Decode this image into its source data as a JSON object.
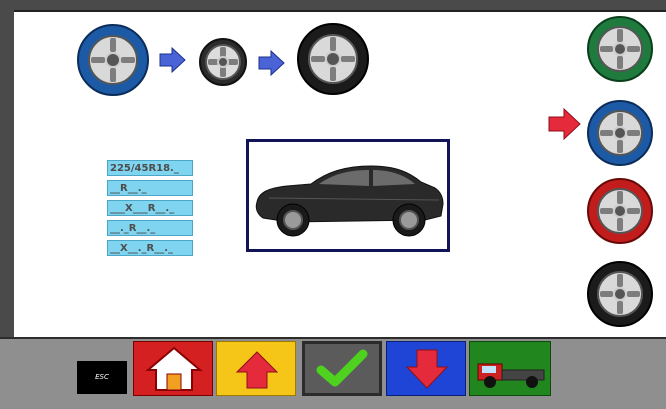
{
  "tire_sizes": [
    "225/45R18._",
    "__R__._",
    "___X___R__._",
    "__._R__._",
    "__X__._R__._"
  ],
  "toolbar": {
    "esc_label": "ESC"
  },
  "colors": {
    "wheel_blue": "#1d5aa6",
    "wheel_green": "#1f7a3d",
    "wheel_red": "#c21d1d",
    "wheel_black": "#1b1b1b",
    "field_bg": "#7fd4ef",
    "car_frame": "#121457",
    "selector_arrow": "#e52b3b"
  },
  "icons": {
    "top_flow": [
      "wheel-blue-icon",
      "arrow-right-icon",
      "wheel-small-icon",
      "arrow-right-icon",
      "wheel-black-icon"
    ],
    "right_wheels": [
      "wheel-green-icon",
      "wheel-blue-icon",
      "wheel-red-icon",
      "wheel-black-icon"
    ],
    "toolbar": [
      "home-icon",
      "arrow-up-icon",
      "checkmark-icon",
      "arrow-down-icon",
      "truck-icon"
    ]
  }
}
